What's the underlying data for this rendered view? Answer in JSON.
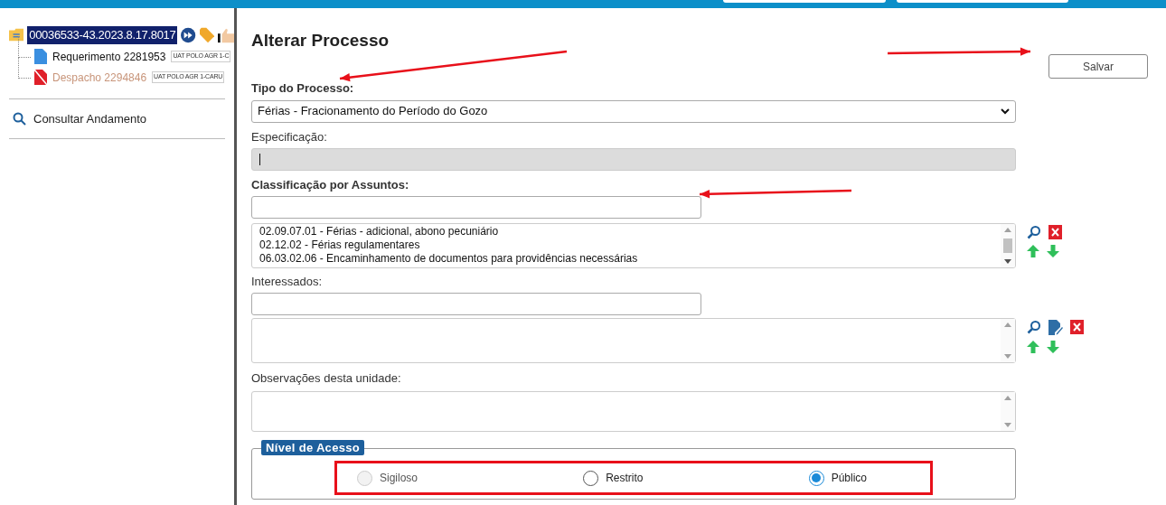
{
  "sidebar": {
    "process": {
      "number": "00036533-43.2023.8.17.8017",
      "selected": true
    },
    "documents": [
      {
        "kind": "document",
        "title": "Requerimento 2281953",
        "unit": "UAT POLO AGR 1-C"
      },
      {
        "kind": "cancelled",
        "title": "Despacho 2294846",
        "unit": "UAT POLO AGR 1-CARU"
      }
    ],
    "links": [
      "Consultar Andamento"
    ]
  },
  "form": {
    "title": "Alterar Processo",
    "save_button": "Salvar",
    "tipo": {
      "label": "Tipo do Processo:",
      "value": "Férias - Fracionamento do Período do Gozo"
    },
    "especificacao": {
      "label": "Especificação:",
      "disabled": true
    },
    "assuntos": {
      "label": "Classificação por Assuntos:",
      "items": [
        "02.09.07.01 - Férias - adicional, abono pecuniário",
        "02.12.02 - Férias regulamentares",
        "06.03.02.06 - Encaminhamento de documentos para providências necessárias"
      ]
    },
    "interessados": {
      "label": "Interessados:"
    },
    "observacoes": {
      "label": "Observações desta unidade:"
    },
    "nivel": {
      "legend": "Nível de Acesso",
      "options": [
        {
          "label": "Sigiloso",
          "selected": false,
          "disabled": true
        },
        {
          "label": "Restrito",
          "selected": false,
          "disabled": false
        },
        {
          "label": "Público",
          "selected": true,
          "disabled": false
        }
      ]
    }
  }
}
